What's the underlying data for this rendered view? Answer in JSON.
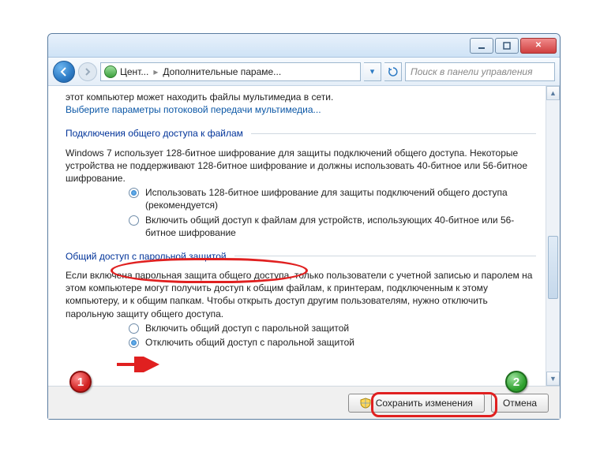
{
  "breadcrumb": {
    "part1": "Цент...",
    "part2": "Дополнительные параме..."
  },
  "search": {
    "placeholder": "Поиск в панели управления"
  },
  "body": {
    "line0": "этот компьютер может находить файлы мультимедиа в сети.",
    "link_stream": "Выберите параметры потоковой передачи мультимедиа...",
    "section_file_conn": "Подключения общего доступа к файлам",
    "file_conn_desc": "Windows 7 использует 128-битное шифрование для защиты подключений общего доступа. Некоторые устройства не поддерживают 128-битное шифрование и должны использовать 40-битное или 56-битное шифрование.",
    "radio_enc128": "Использовать 128-битное шифрование для защиты подключений общего доступа (рекомендуется)",
    "radio_enc40": "Включить общий доступ к файлам для устройств, использующих 40-битное или 56-битное шифрование",
    "section_pw": "Общий доступ с парольной защитой",
    "pw_desc": "Если включена парольная защита общего доступа, только пользователи с учетной записью и паролем на этом компьютере могут получить доступ к общим файлам, к принтерам, подключенным к этому компьютеру, и к общим папкам. Чтобы открыть доступ другим пользователям, нужно отключить парольную защиту общего доступа.",
    "radio_pw_on": "Включить общий доступ с парольной защитой",
    "radio_pw_off": "Отключить общий доступ с парольной защитой"
  },
  "footer": {
    "save": "Сохранить изменения",
    "cancel": "Отмена"
  },
  "annotations": {
    "one": "1",
    "two": "2"
  }
}
